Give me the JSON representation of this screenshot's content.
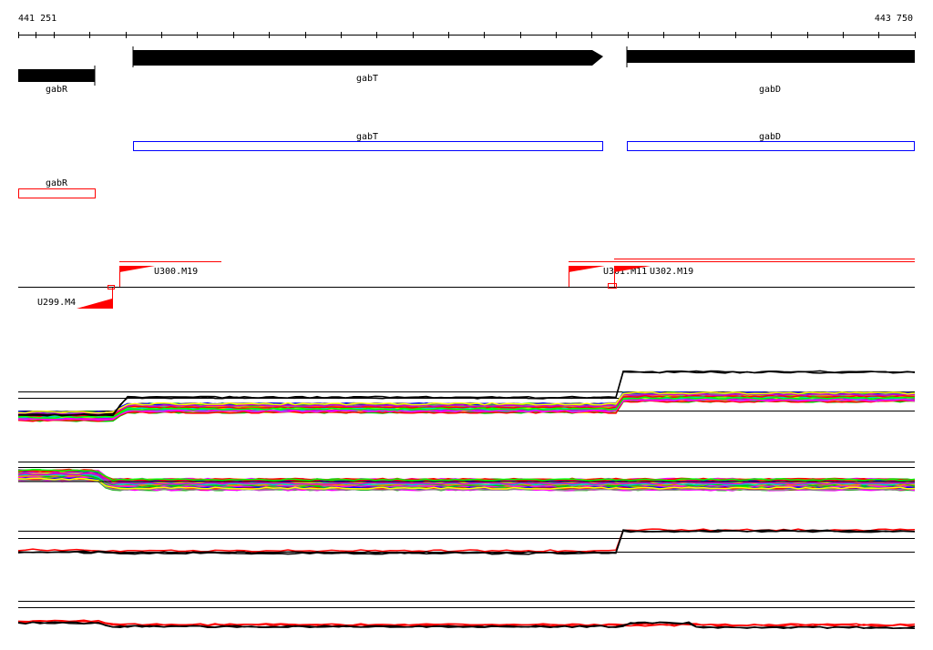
{
  "ruler": {
    "start_label": "441 251",
    "end_label": "443 750"
  },
  "genes": [
    {
      "name": "gabR",
      "strand": "-"
    },
    {
      "name": "gabT",
      "strand": "+"
    },
    {
      "name": "gabD",
      "strand": "+"
    }
  ],
  "cds_blue": [
    {
      "name": "gabT"
    },
    {
      "name": "gabD"
    }
  ],
  "cds_red": [
    {
      "name": "gabR"
    }
  ],
  "transcripts": [
    {
      "name": "U299.M4"
    },
    {
      "name": "U300.M19"
    },
    {
      "name": "U301.M11"
    },
    {
      "name": "U302.M19"
    }
  ],
  "colors": {
    "axis": "#000000",
    "blue_box": "#0000ff",
    "red": "#ff0000",
    "trace_palette": [
      "#ff00ff",
      "#0000ff",
      "#00cc00",
      "#ff8800",
      "#00cccc",
      "#ff0000",
      "#888888",
      "#cc00cc",
      "#ffff00",
      "#00ff00"
    ]
  }
}
